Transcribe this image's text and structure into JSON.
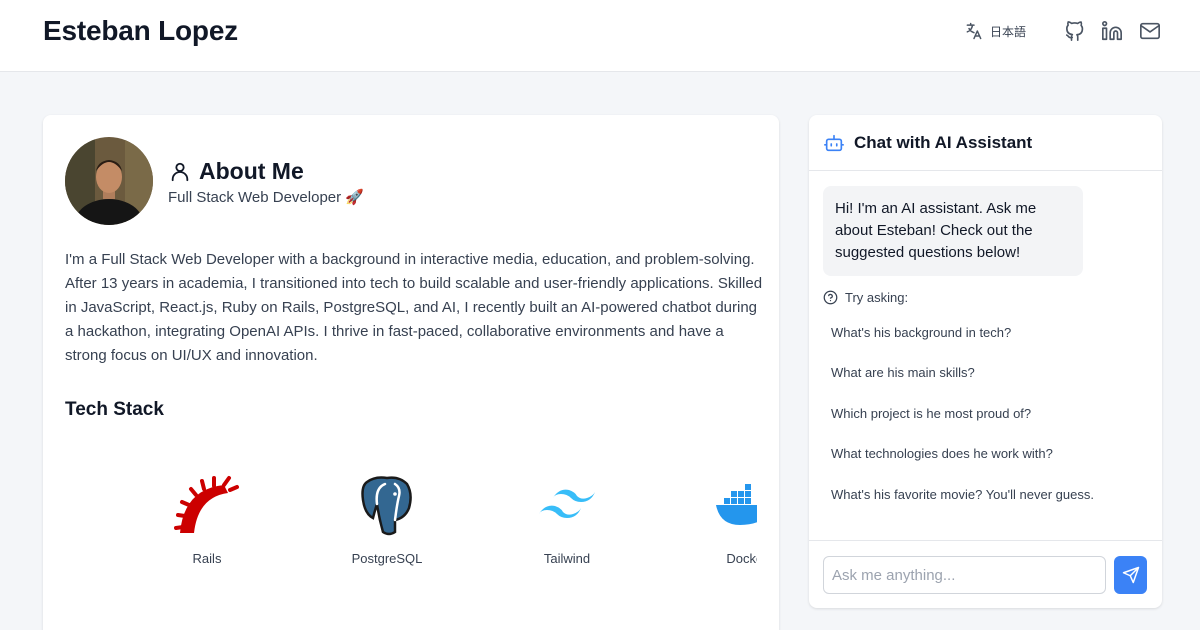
{
  "header": {
    "site_title": "Esteban Lopez",
    "language_label": "日本語",
    "icons": [
      "translate-icon",
      "github-icon",
      "linkedin-icon",
      "mail-icon"
    ]
  },
  "about": {
    "title": "About Me",
    "subtitle": "Full Stack Web Developer 🚀",
    "bio": "I'm a Full Stack Web Developer with a background in interactive media, education, and problem-solving. After 13 years in academia, I transitioned into tech to build scalable and user-friendly applications. Skilled in JavaScript, React.js, Ruby on Rails, PostgreSQL, and AI, I recently built an AI-powered chatbot during a hackathon, integrating OpenAI APIs. I thrive in fast-paced, collaborative environments and have a strong focus on UI/UX and innovation.",
    "tech_heading": "Tech Stack",
    "tech_stack": [
      {
        "name": "Rails",
        "icon": "rails-logo-icon"
      },
      {
        "name": "PostgreSQL",
        "icon": "postgresql-logo-icon"
      },
      {
        "name": "Tailwind",
        "icon": "tailwind-logo-icon"
      },
      {
        "name": "Docker",
        "icon": "docker-logo-icon"
      }
    ]
  },
  "chat": {
    "title": "Chat with AI Assistant",
    "greeting": "Hi! I'm an AI assistant. Ask me about Esteban! Check out the suggested questions below!",
    "try_label": "Try asking:",
    "suggestions": [
      "What's his background in tech?",
      "What are his main skills?",
      "Which project is he most proud of?",
      "What technologies does he work with?",
      "What's his favorite movie? You'll never guess."
    ],
    "input_placeholder": "Ask me anything..."
  },
  "colors": {
    "accent": "#3b82f6",
    "page_bg": "#f4f6f9",
    "card_bg": "#ffffff",
    "rails_red": "#cc0000",
    "postgres_blue": "#336791",
    "tailwind_cyan": "#38bdf8",
    "docker_blue": "#2496ed"
  }
}
